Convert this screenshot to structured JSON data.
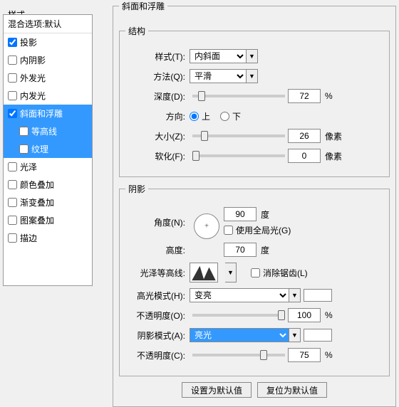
{
  "left": {
    "title": "样式",
    "blend": "混合选项:默认",
    "items": [
      {
        "label": "投影",
        "checked": true,
        "selected": false
      },
      {
        "label": "内阴影",
        "checked": false,
        "selected": false
      },
      {
        "label": "外发光",
        "checked": false,
        "selected": false
      },
      {
        "label": "内发光",
        "checked": false,
        "selected": false
      },
      {
        "label": "斜面和浮雕",
        "checked": true,
        "selected": true
      },
      {
        "label": "等高线",
        "checked": false,
        "selected": true,
        "sub": true
      },
      {
        "label": "纹理",
        "checked": false,
        "selected": true,
        "sub": true
      },
      {
        "label": "光泽",
        "checked": false,
        "selected": false
      },
      {
        "label": "颜色叠加",
        "checked": false,
        "selected": false
      },
      {
        "label": "渐变叠加",
        "checked": false,
        "selected": false
      },
      {
        "label": "图案叠加",
        "checked": false,
        "selected": false
      },
      {
        "label": "描边",
        "checked": false,
        "selected": false
      }
    ]
  },
  "main_legend": "斜面和浮雕",
  "structure": {
    "legend": "结构",
    "style_label": "样式(T):",
    "style_value": "内斜面",
    "method_label": "方法(Q):",
    "method_value": "平滑",
    "depth_label": "深度(D):",
    "depth_value": "72",
    "depth_unit": "%",
    "direction_label": "方向:",
    "up_label": "上",
    "down_label": "下",
    "size_label": "大小(Z):",
    "size_value": "26",
    "size_unit": "像素",
    "soften_label": "软化(F):",
    "soften_value": "0",
    "soften_unit": "像素"
  },
  "shading": {
    "legend": "阴影",
    "angle_label": "角度(N):",
    "angle_value": "90",
    "angle_unit": "度",
    "global_label": "使用全局光(G)",
    "altitude_label": "高度:",
    "altitude_value": "70",
    "altitude_unit": "度",
    "gloss_label": "光泽等高线:",
    "anti_label": "消除锯齿(L)",
    "highlight_label": "高光模式(H):",
    "highlight_value": "变亮",
    "highlight_op_label": "不透明度(O):",
    "highlight_op_value": "100",
    "highlight_op_unit": "%",
    "shadow_label": "阴影模式(A):",
    "shadow_value": "亮光",
    "shadow_op_label": "不透明度(C):",
    "shadow_op_value": "75",
    "shadow_op_unit": "%"
  },
  "buttons": {
    "default": "设置为默认值",
    "reset": "复位为默认值"
  }
}
